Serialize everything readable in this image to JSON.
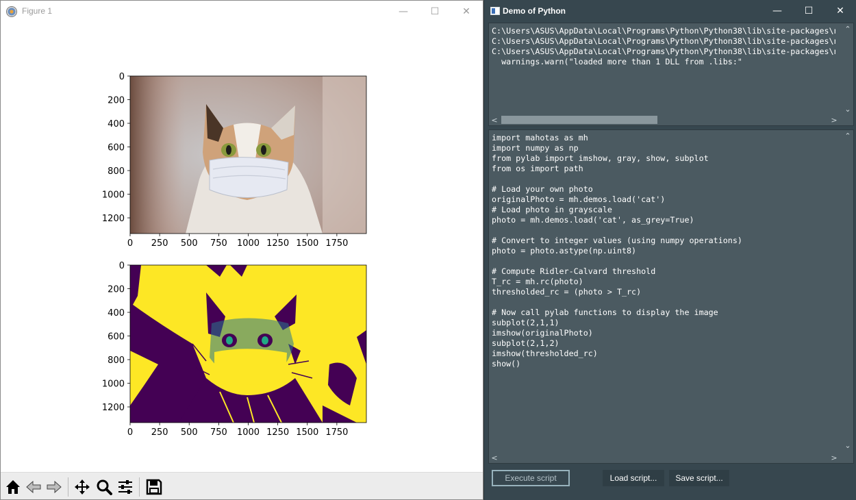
{
  "figure_window": {
    "title": "Figure 1",
    "controls": {
      "minimize": "—",
      "maximize": "☐",
      "close": "✕"
    },
    "axes_top": {
      "image": "color photo of a cat wearing a surgical mask",
      "xticks": [
        "0",
        "250",
        "500",
        "750",
        "1000",
        "1250",
        "1500",
        "1750"
      ],
      "yticks": [
        "0",
        "200",
        "400",
        "600",
        "800",
        "1000",
        "1200"
      ]
    },
    "axes_bottom": {
      "image": "thresholded cat image (yellow/dark purple)",
      "xticks": [
        "0",
        "250",
        "500",
        "750",
        "1000",
        "1250",
        "1500",
        "1750"
      ],
      "yticks": [
        "0",
        "200",
        "400",
        "600",
        "800",
        "1000",
        "1200"
      ]
    },
    "toolbar": [
      "home-icon",
      "back-icon",
      "forward-icon",
      "pan-icon",
      "zoom-icon",
      "configure-subplots-icon",
      "save-icon"
    ]
  },
  "python_window": {
    "title": "Demo of Python",
    "controls": {
      "minimize": "—",
      "maximize": "☐",
      "close": "✕"
    },
    "output_lines": [
      "C:\\Users\\ASUS\\AppData\\Local\\Programs\\Python\\Python38\\lib\\site-packages\\n",
      "C:\\Users\\ASUS\\AppData\\Local\\Programs\\Python\\Python38\\lib\\site-packages\\n",
      "C:\\Users\\ASUS\\AppData\\Local\\Programs\\Python\\Python38\\lib\\site-packages\\n",
      "  warnings.warn(\"loaded more than 1 DLL from .libs:\""
    ],
    "code_lines": [
      "import mahotas as mh",
      "import numpy as np",
      "from pylab import imshow, gray, show, subplot",
      "from os import path",
      "",
      "# Load your own photo",
      "originalPhoto = mh.demos.load('cat')",
      "# Load photo in grayscale",
      "photo = mh.demos.load('cat', as_grey=True)",
      "",
      "# Convert to integer values (using numpy operations)",
      "photo = photo.astype(np.uint8)",
      "",
      "# Compute Ridler-Calvard threshold",
      "T_rc = mh.rc(photo)",
      "thresholded_rc = (photo > T_rc)",
      "",
      "# Now call pylab functions to display the image",
      "subplot(2,1,1)",
      "imshow(originalPhoto)",
      "subplot(2,1,2)",
      "imshow(thresholded_rc)",
      "show()"
    ],
    "buttons": {
      "execute": "Execute script",
      "load": "Load script...",
      "save": "Save script..."
    },
    "scroll_arrows": {
      "up": "⌃",
      "down": "⌄",
      "left": "<",
      "right": ">"
    }
  }
}
